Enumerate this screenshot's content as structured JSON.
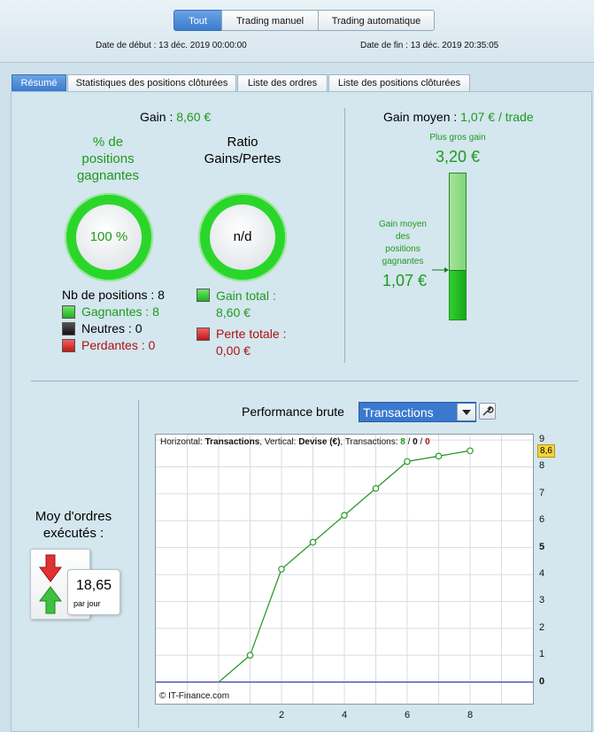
{
  "header": {
    "tabs": [
      {
        "label": "Tout",
        "active": true
      },
      {
        "label": "Trading manuel",
        "active": false
      },
      {
        "label": "Trading automatique",
        "active": false
      }
    ],
    "start_label": "Date de début :",
    "start_value": "13 déc. 2019 00:00:00",
    "end_label": "Date de fin :",
    "end_value": "13 déc. 2019 20:35:05"
  },
  "subtabs": [
    {
      "label": "Résumé",
      "active": true
    },
    {
      "label": "Statistiques des positions clôturées",
      "active": false
    },
    {
      "label": "Liste des ordres",
      "active": false
    },
    {
      "label": "Liste des positions clôturées",
      "active": false
    }
  ],
  "summary": {
    "gain_label": "Gain :",
    "gain_value": "8,60 €",
    "pct_label_1": "% de",
    "pct_label_2": "positions",
    "pct_label_3": "gagnantes",
    "pct_value": "100 %",
    "ratio_label_1": "Ratio",
    "ratio_label_2": "Gains/Pertes",
    "ratio_value": "n/d",
    "nb_positions": "Nb de positions : 8",
    "gagnantes": "Gagnantes : 8",
    "neutres": "Neutres : 0",
    "perdantes": "Perdantes : 0",
    "gain_total_label": "Gain total :",
    "gain_total_value": "8,60 €",
    "perte_totale_label": "Perte totale :",
    "perte_totale_value": "0,00 €"
  },
  "avg": {
    "gain_moyen_label": "Gain moyen :",
    "gain_moyen_value": "1,07 € / trade",
    "plus_gros_label": "Plus gros gain",
    "plus_gros_value": "3,20 €",
    "avg_win_1": "Gain moyen",
    "avg_win_2": "des",
    "avg_win_3": "positions",
    "avg_win_4": "gagnantes",
    "avg_win_value": "1,07 €",
    "bar_fill_fraction": 0.334
  },
  "orders": {
    "label_1": "Moy d'ordres",
    "label_2": "exécutés :",
    "value": "18,65",
    "unit": "par jour"
  },
  "performance": {
    "label": "Performance brute",
    "selected": "Transactions"
  },
  "chart_data": {
    "type": "line",
    "info_prefix": "Horizontal: ",
    "info_h": "Transactions",
    "info_mid": ", Vertical: ",
    "info_v": "Devise (€)",
    "info_tx": ", Transactions: ",
    "info_w": "8",
    "info_sep": " / ",
    "info_n": "0",
    "info_l": "0",
    "x": [
      0,
      1,
      2,
      3,
      4,
      5,
      6,
      7,
      8
    ],
    "y": [
      0,
      1.0,
      4.2,
      5.2,
      6.2,
      7.2,
      8.2,
      8.4,
      8.6
    ],
    "xlim": [
      -2,
      10
    ],
    "ylim": [
      -0.8,
      9.2
    ],
    "x_ticks": [
      "2",
      "4",
      "6",
      "8"
    ],
    "y_ticks": [
      "0",
      "1",
      "2",
      "3",
      "4",
      "5",
      "6",
      "7",
      "8",
      "9"
    ],
    "last_value_label": "8,6",
    "copyright": "© IT-Finance.com",
    "line_color": "#2a9a2a",
    "baseline_color": "#1a1aaa",
    "grid": true
  }
}
